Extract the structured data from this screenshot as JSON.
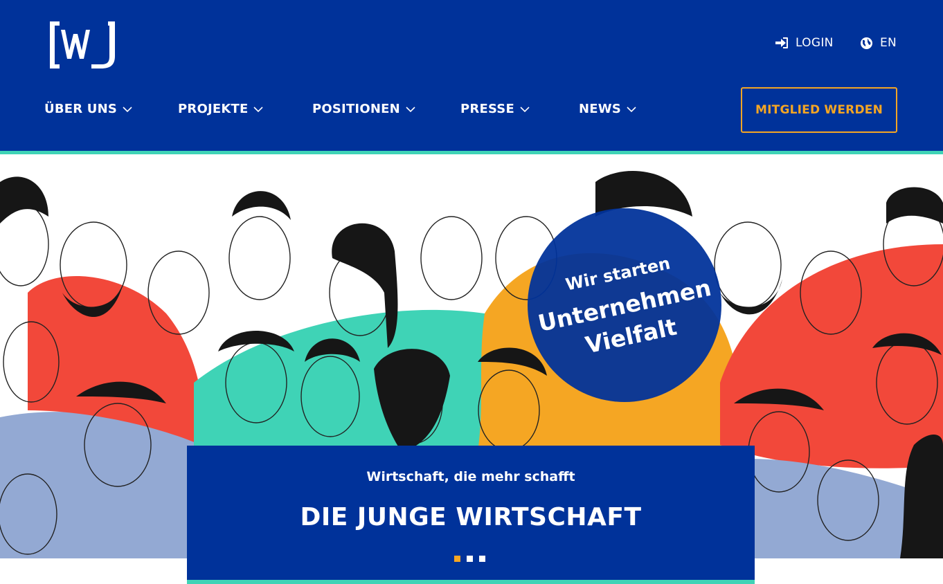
{
  "brand": {
    "logo_text": "[WJ]",
    "primary": "#00329a",
    "accent": "#f5a623",
    "stripe": "#3fd3b6"
  },
  "utility": {
    "login_label": "LOGIN",
    "login_icon": "sign-in-icon",
    "lang_label": "EN",
    "lang_icon": "globe-icon"
  },
  "nav": {
    "items": [
      {
        "label": "ÜBER UNS"
      },
      {
        "label": "PROJEKTE"
      },
      {
        "label": "POSITIONEN"
      },
      {
        "label": "PRESSE"
      },
      {
        "label": "NEWS"
      }
    ],
    "cta_label": "MITGLIED WERDEN"
  },
  "hero": {
    "badge_line1": "Wir starten",
    "badge_line2": "Unternehmen",
    "badge_line3": "Vielfalt",
    "subline": "Wirtschaft, die mehr schafft",
    "headline": "DIE JUNGE WIRTSCHAFT",
    "slides_total": 3,
    "slide_active": 1
  }
}
